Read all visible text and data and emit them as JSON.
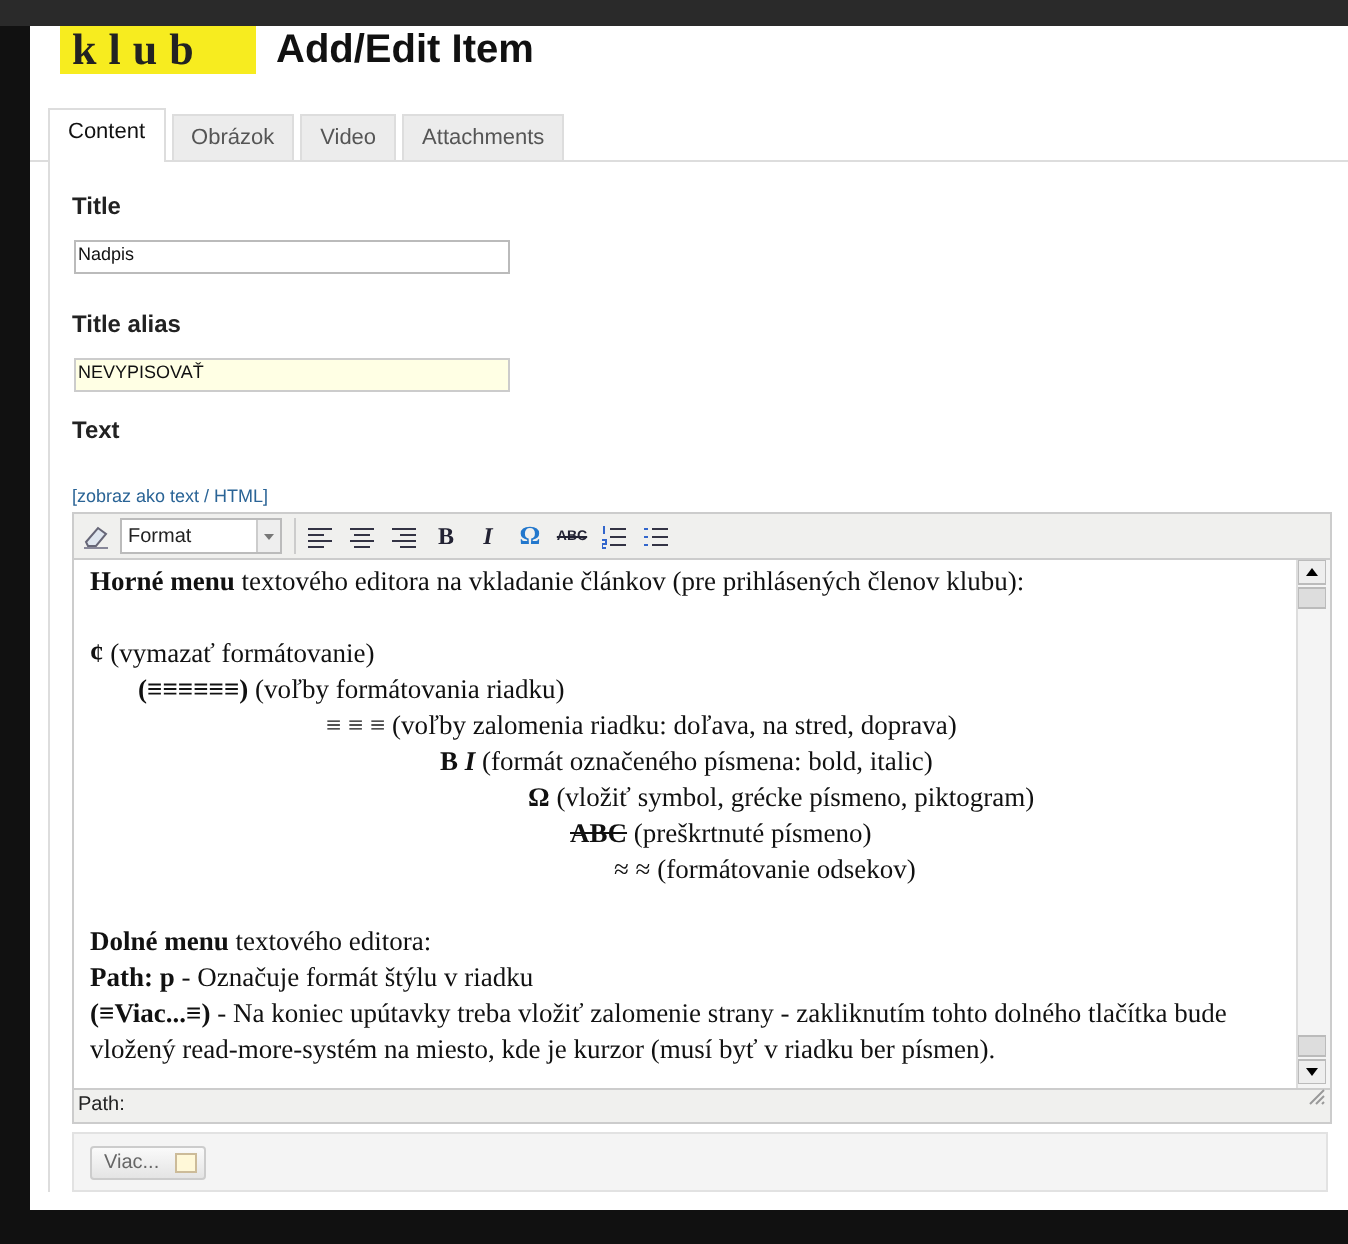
{
  "header": {
    "logo": "klub",
    "title": "Add/Edit Item"
  },
  "tabs": [
    {
      "label": "Content",
      "selected": true
    },
    {
      "label": "Obrázok",
      "selected": false
    },
    {
      "label": "Video",
      "selected": false
    },
    {
      "label": "Attachments",
      "selected": false
    }
  ],
  "fields": [
    {
      "label": "Title",
      "value": "Nadpis",
      "focused": false
    },
    {
      "label": "Title alias",
      "value": "NEVYPISOVAŤ",
      "focused": true
    }
  ],
  "text_section": {
    "label": "Text",
    "toggle_link": "[zobraz ako text / HTML]"
  },
  "toolbar": [
    {
      "kind": "eraser"
    },
    {
      "kind": "select",
      "label": "Format"
    },
    {
      "kind": "align-left"
    },
    {
      "kind": "align-center"
    },
    {
      "kind": "align-right"
    },
    {
      "kind": "bold",
      "label": "B"
    },
    {
      "kind": "italic",
      "label": "I"
    },
    {
      "kind": "symbol",
      "label": "Ω"
    },
    {
      "kind": "strike",
      "label": "ABC"
    },
    {
      "kind": "ordered-list"
    },
    {
      "kind": "bullet-list"
    }
  ],
  "editor_content": [
    {
      "kind": "paragraph",
      "text": "**Horné menu** textového editora na vkladanie článkov (pre prihlásených členov klubu):"
    },
    {
      "kind": "legend",
      "items": [
        {
          "symbol": "¢",
          "kind": "bold",
          "text": "(vymazať formátovanie)"
        },
        {
          "symbol": "(≡≡≡≡≡≡)",
          "kind": "bold",
          "text": "(voľby formátovania riadku)"
        },
        {
          "symbol": "≡ ≡ ≡",
          "kind": "plain",
          "text": "(voľby zalomenia riadku: doľava, na stred, doprava)"
        },
        {
          "symbol": "B *I*",
          "kind": "bold",
          "text": "(formát označeného písmena: bold, italic)"
        },
        {
          "symbol": "Ω",
          "kind": "bold",
          "text": "(vložiť symbol, grécke písmeno, piktogram)"
        },
        {
          "symbol": "ABC",
          "kind": "strike",
          "text": "(preškrtnuté písmeno)"
        },
        {
          "symbol": "≈ ≈",
          "kind": "plain",
          "text": "(formátovanie odsekov)"
        }
      ]
    },
    {
      "kind": "line",
      "text": "**Dolné menu** textového editora:"
    },
    {
      "kind": "line",
      "text": "**Path: p**  - Označuje formát štýlu v riadku"
    },
    {
      "kind": "line",
      "text": "**(≡Viac...≡)** - Na koniec upútavky treba vložiť zalomenie strany - zakliknutím tohto dolného tlačítka bude vložený read-more-systém na miesto, kde je kurzor (musí byť v riadku ber písmen)."
    }
  ],
  "path_bar": {
    "label": "Path:"
  },
  "more_button": {
    "label": "Viac..."
  }
}
